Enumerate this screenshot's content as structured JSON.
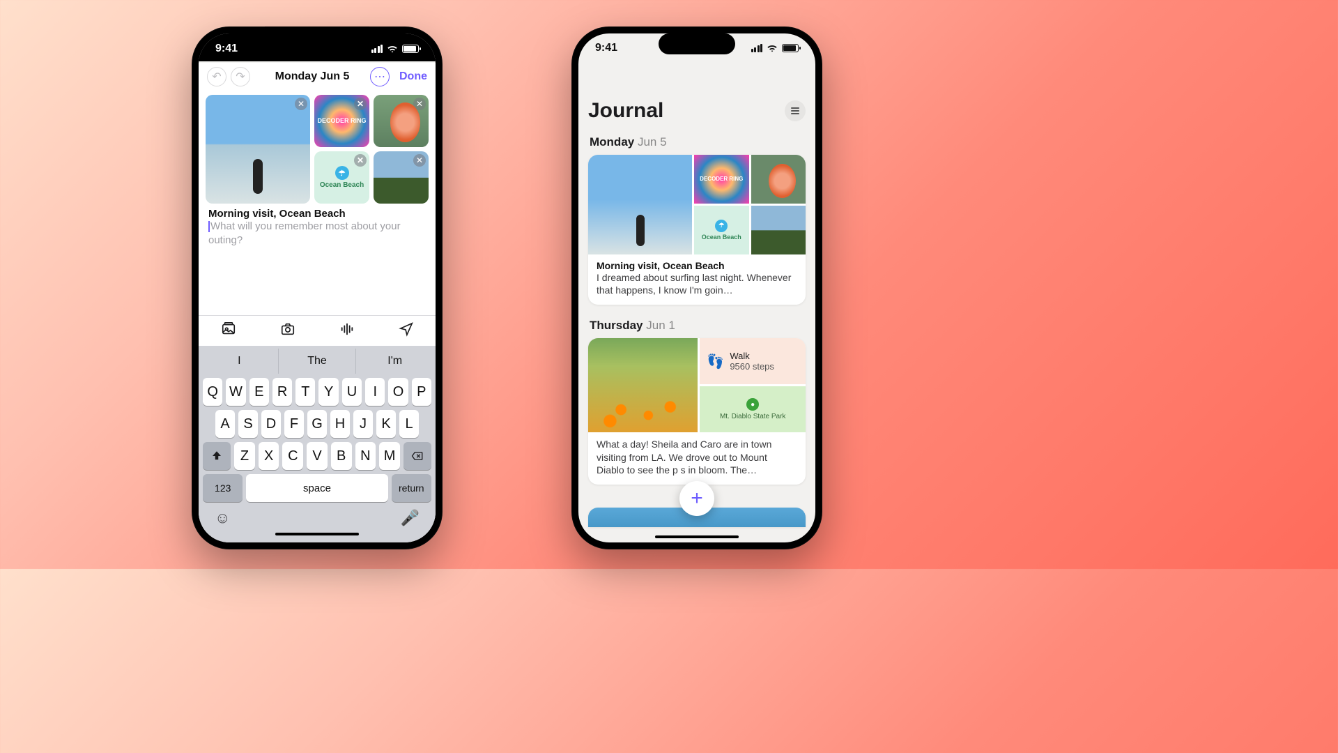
{
  "status": {
    "time": "9:41"
  },
  "editor": {
    "date_label": "Monday Jun 5",
    "done": "Done",
    "title": "Morning visit, Ocean Beach",
    "placeholder": "What will you remember most about your outing?",
    "decoder_text": "DECODER RING",
    "map_label": "Ocean Beach"
  },
  "keyboard": {
    "suggestions": [
      "I",
      "The",
      "I'm"
    ],
    "row1": [
      "Q",
      "W",
      "E",
      "R",
      "T",
      "Y",
      "U",
      "I",
      "O",
      "P"
    ],
    "row2": [
      "A",
      "S",
      "D",
      "F",
      "G",
      "H",
      "J",
      "K",
      "L"
    ],
    "row3": [
      "Z",
      "X",
      "C",
      "V",
      "B",
      "N",
      "M"
    ],
    "numkey": "123",
    "space": "space",
    "return": "return"
  },
  "journal": {
    "title": "Journal",
    "days": [
      {
        "dow": "Monday",
        "date": "Jun 5"
      },
      {
        "dow": "Thursday",
        "date": "Jun 1"
      }
    ],
    "card1": {
      "decoder_text": "DECODER RING",
      "map_label": "Ocean Beach",
      "title": "Morning visit, Ocean Beach",
      "body": "I dreamed about surfing last night. Whenever that happens, I know I'm goin…"
    },
    "card2": {
      "walk_label": "Walk",
      "walk_steps": "9560 steps",
      "park_label": "Mt. Diablo State Park",
      "body": "What a day! Sheila and Caro are in town visiting from LA. We drove out to Mount Diablo to see the p         s in bloom. The…"
    }
  }
}
